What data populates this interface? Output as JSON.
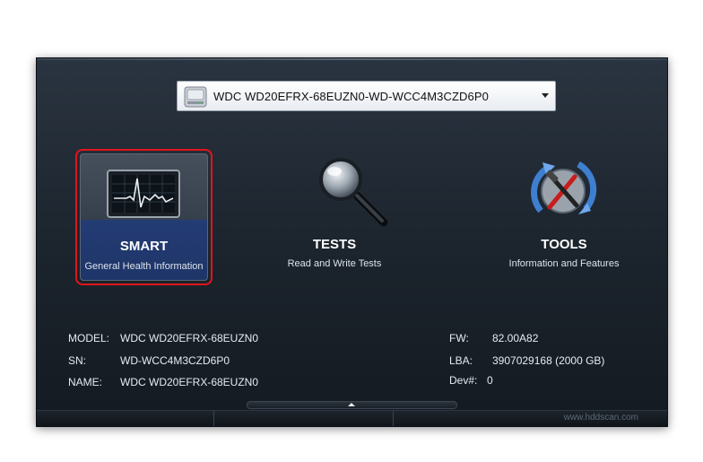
{
  "drive": {
    "selected": "WDC WD20EFRX-68EUZN0-WD-WCC4M3CZD6P0",
    "icon": "hard-drive-icon"
  },
  "tiles": {
    "smart": {
      "title": "SMART",
      "subtitle": "General Health Information",
      "icon": "monitor-heartbeat-icon"
    },
    "tests": {
      "title": "TESTS",
      "subtitle": "Read and Write Tests",
      "icon": "magnifier-icon"
    },
    "tools": {
      "title": "TOOLS",
      "subtitle": "Information and Features",
      "icon": "tools-icon"
    }
  },
  "info": {
    "model_label": "MODEL:",
    "model_value": "WDC WD20EFRX-68EUZN0",
    "sn_label": "SN:",
    "sn_value": "WD-WCC4M3CZD6P0",
    "name_label": "NAME:",
    "name_value": "WDC WD20EFRX-68EUZN0",
    "fw_label": "FW:",
    "fw_value": "82.00A82",
    "lba_label": "LBA:",
    "lba_value": "3907029168 (2000 GB)",
    "dev_label": "Dev#:",
    "dev_value": "0"
  },
  "footer": {
    "watermark": "www.hddscan.com"
  },
  "colors": {
    "selection_border": "#e3141c",
    "tile_highlight": "#233c74"
  }
}
